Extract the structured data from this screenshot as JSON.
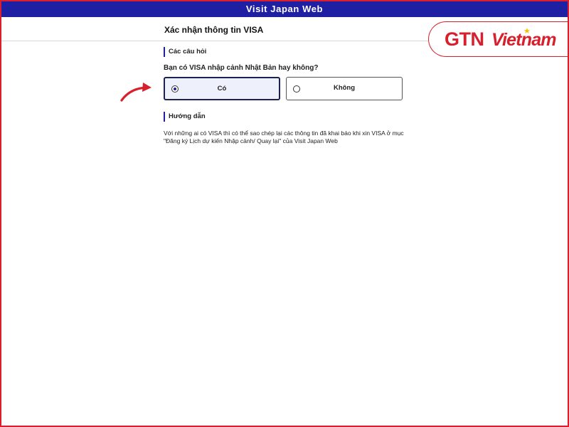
{
  "app": {
    "title": "Visit Japan Web"
  },
  "page": {
    "title": "Xác nhận thông tin VISA"
  },
  "logo": {
    "brand": "GTN",
    "country": "Vietnam"
  },
  "questions_section": {
    "label": "Các câu hỏi",
    "question": "Bạn có VISA nhập cảnh Nhật Bản hay không?",
    "options": [
      {
        "label": "Có",
        "selected": true
      },
      {
        "label": "Không",
        "selected": false
      }
    ]
  },
  "guide_section": {
    "label": "Hướng dẫn",
    "text": "Với những ai có VISA thì có thể sao chép lại các thông tin đã khai báo khi xin VISA ở mục \"Đăng ký Lịch dự kiến Nhập cảnh/ Quay lại\" của Visit Japan Web"
  },
  "colors": {
    "topbar": "#1f1fa3",
    "frame": "#d7202c",
    "brand_red": "#d7202c",
    "selected_card_bg": "#eef0fb",
    "arrow": "#d7202c"
  },
  "icons": {
    "arrow": "annotation-arrow-icon",
    "radio_checked": "radio-checked-icon",
    "radio_unchecked": "radio-unchecked-icon"
  }
}
